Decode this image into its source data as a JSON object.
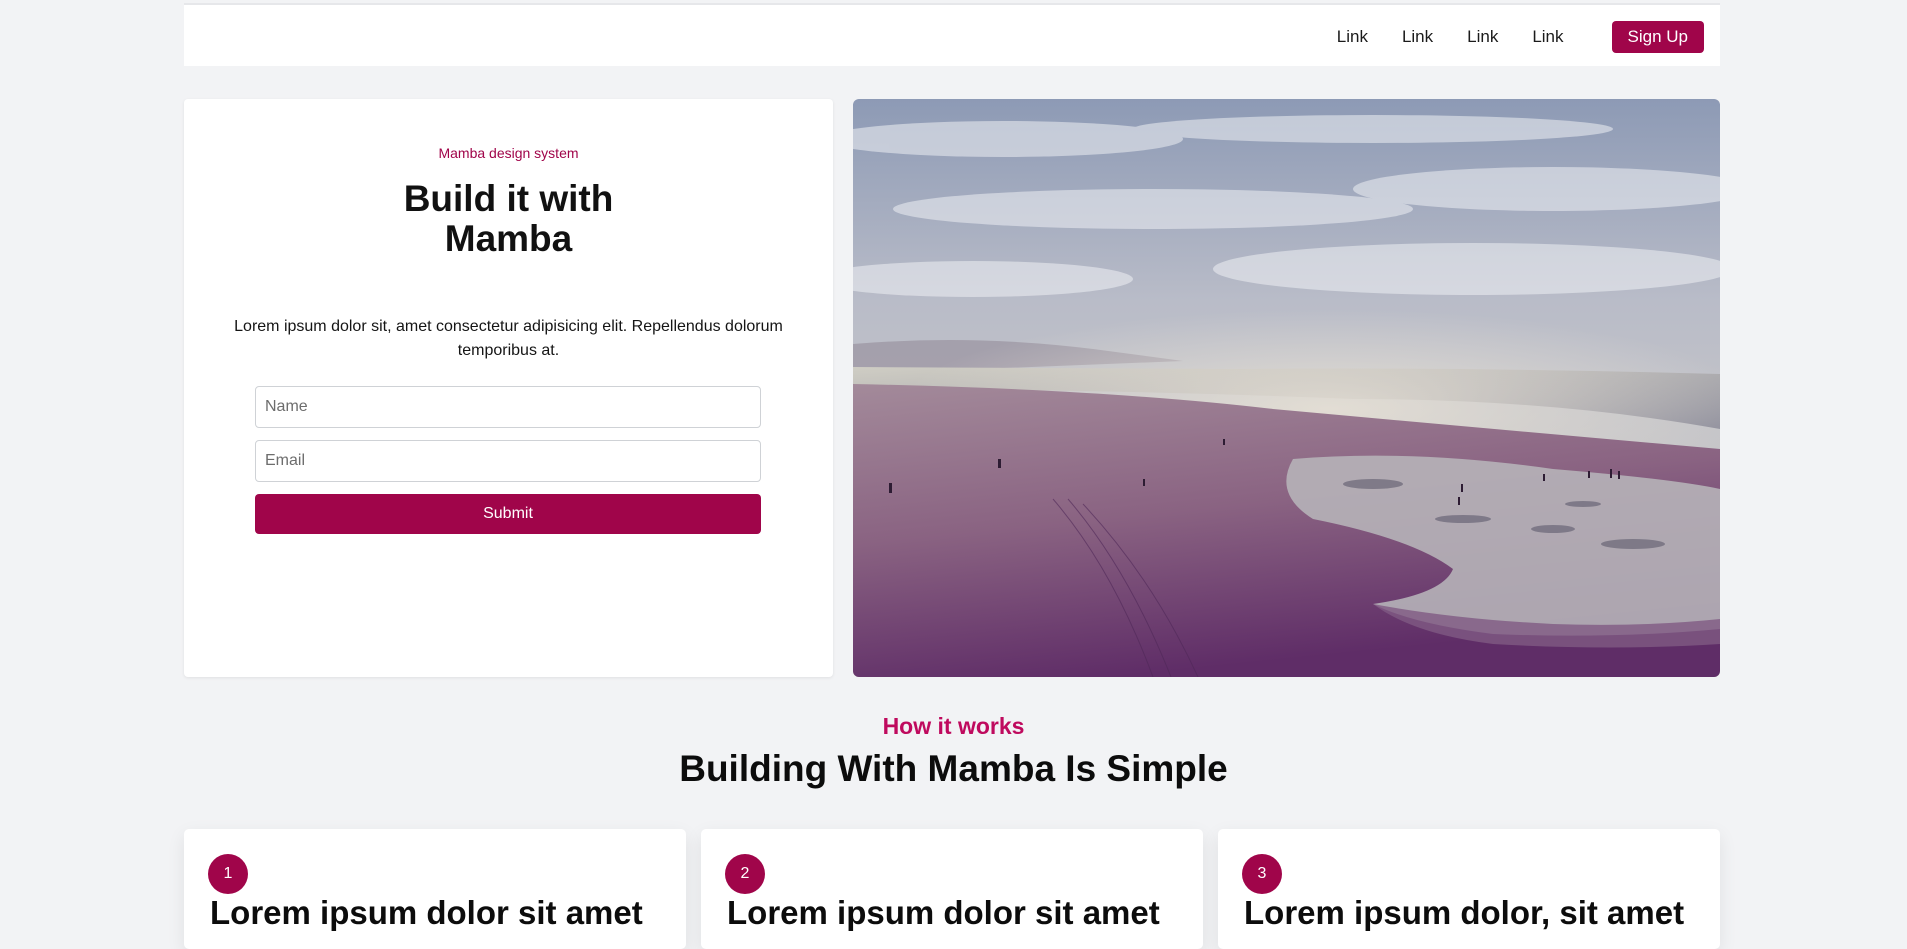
{
  "navbar": {
    "links": [
      "Link",
      "Link",
      "Link",
      "Link"
    ],
    "signup_label": "Sign Up"
  },
  "hero": {
    "eyebrow": "Mamba design system",
    "title_line1": "Build it with",
    "title_line2": "Mamba",
    "text": "Lorem ipsum dolor sit, amet consectetur adipisicing elit. Repellendus dolorum temporibus at.",
    "form": {
      "name_placeholder": "Name",
      "email_placeholder": "Email",
      "submit_label": "Submit"
    }
  },
  "how": {
    "kicker": "How it works",
    "title": "Building With Mamba Is Simple",
    "steps": [
      {
        "number": "1",
        "heading": "Lorem ipsum dolor sit amet"
      },
      {
        "number": "2",
        "heading": "Lorem ipsum dolor sit amet"
      },
      {
        "number": "3",
        "heading": "Lorem ipsum dolor, sit amet"
      }
    ]
  },
  "colors": {
    "brand": "#a0054a",
    "accent_text": "#bf0a5e",
    "page_background": "#f2f3f5"
  },
  "image": {
    "subject": "beach-landscape-photo"
  }
}
